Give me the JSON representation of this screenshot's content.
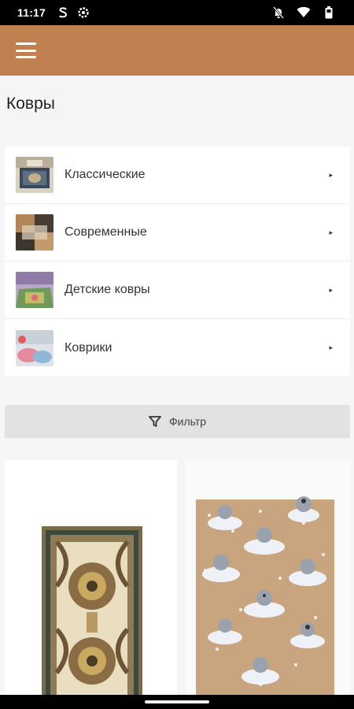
{
  "status_bar": {
    "time": "11:17",
    "icons": [
      "s-badge-icon",
      "settings-icon",
      "bell-off-icon",
      "wifi-icon",
      "battery-icon"
    ]
  },
  "app_bar": {
    "color": "#c1804f",
    "menu_icon": "hamburger-menu-icon"
  },
  "page": {
    "title": "Ковры"
  },
  "categories": [
    {
      "label": "Классические",
      "thumb_icon": "classic-rug-thumbnail"
    },
    {
      "label": "Современные",
      "thumb_icon": "modern-rug-thumbnail"
    },
    {
      "label": "Детские ковры",
      "thumb_icon": "kids-rug-thumbnail"
    },
    {
      "label": "Коврики",
      "thumb_icon": "small-rug-thumbnail"
    }
  ],
  "filter": {
    "label": "Фильтр",
    "icon": "filter-icon"
  },
  "products": [
    {
      "image": "ornamental-beige-rug-image"
    },
    {
      "image": "kids-cartoon-rug-image"
    }
  ]
}
